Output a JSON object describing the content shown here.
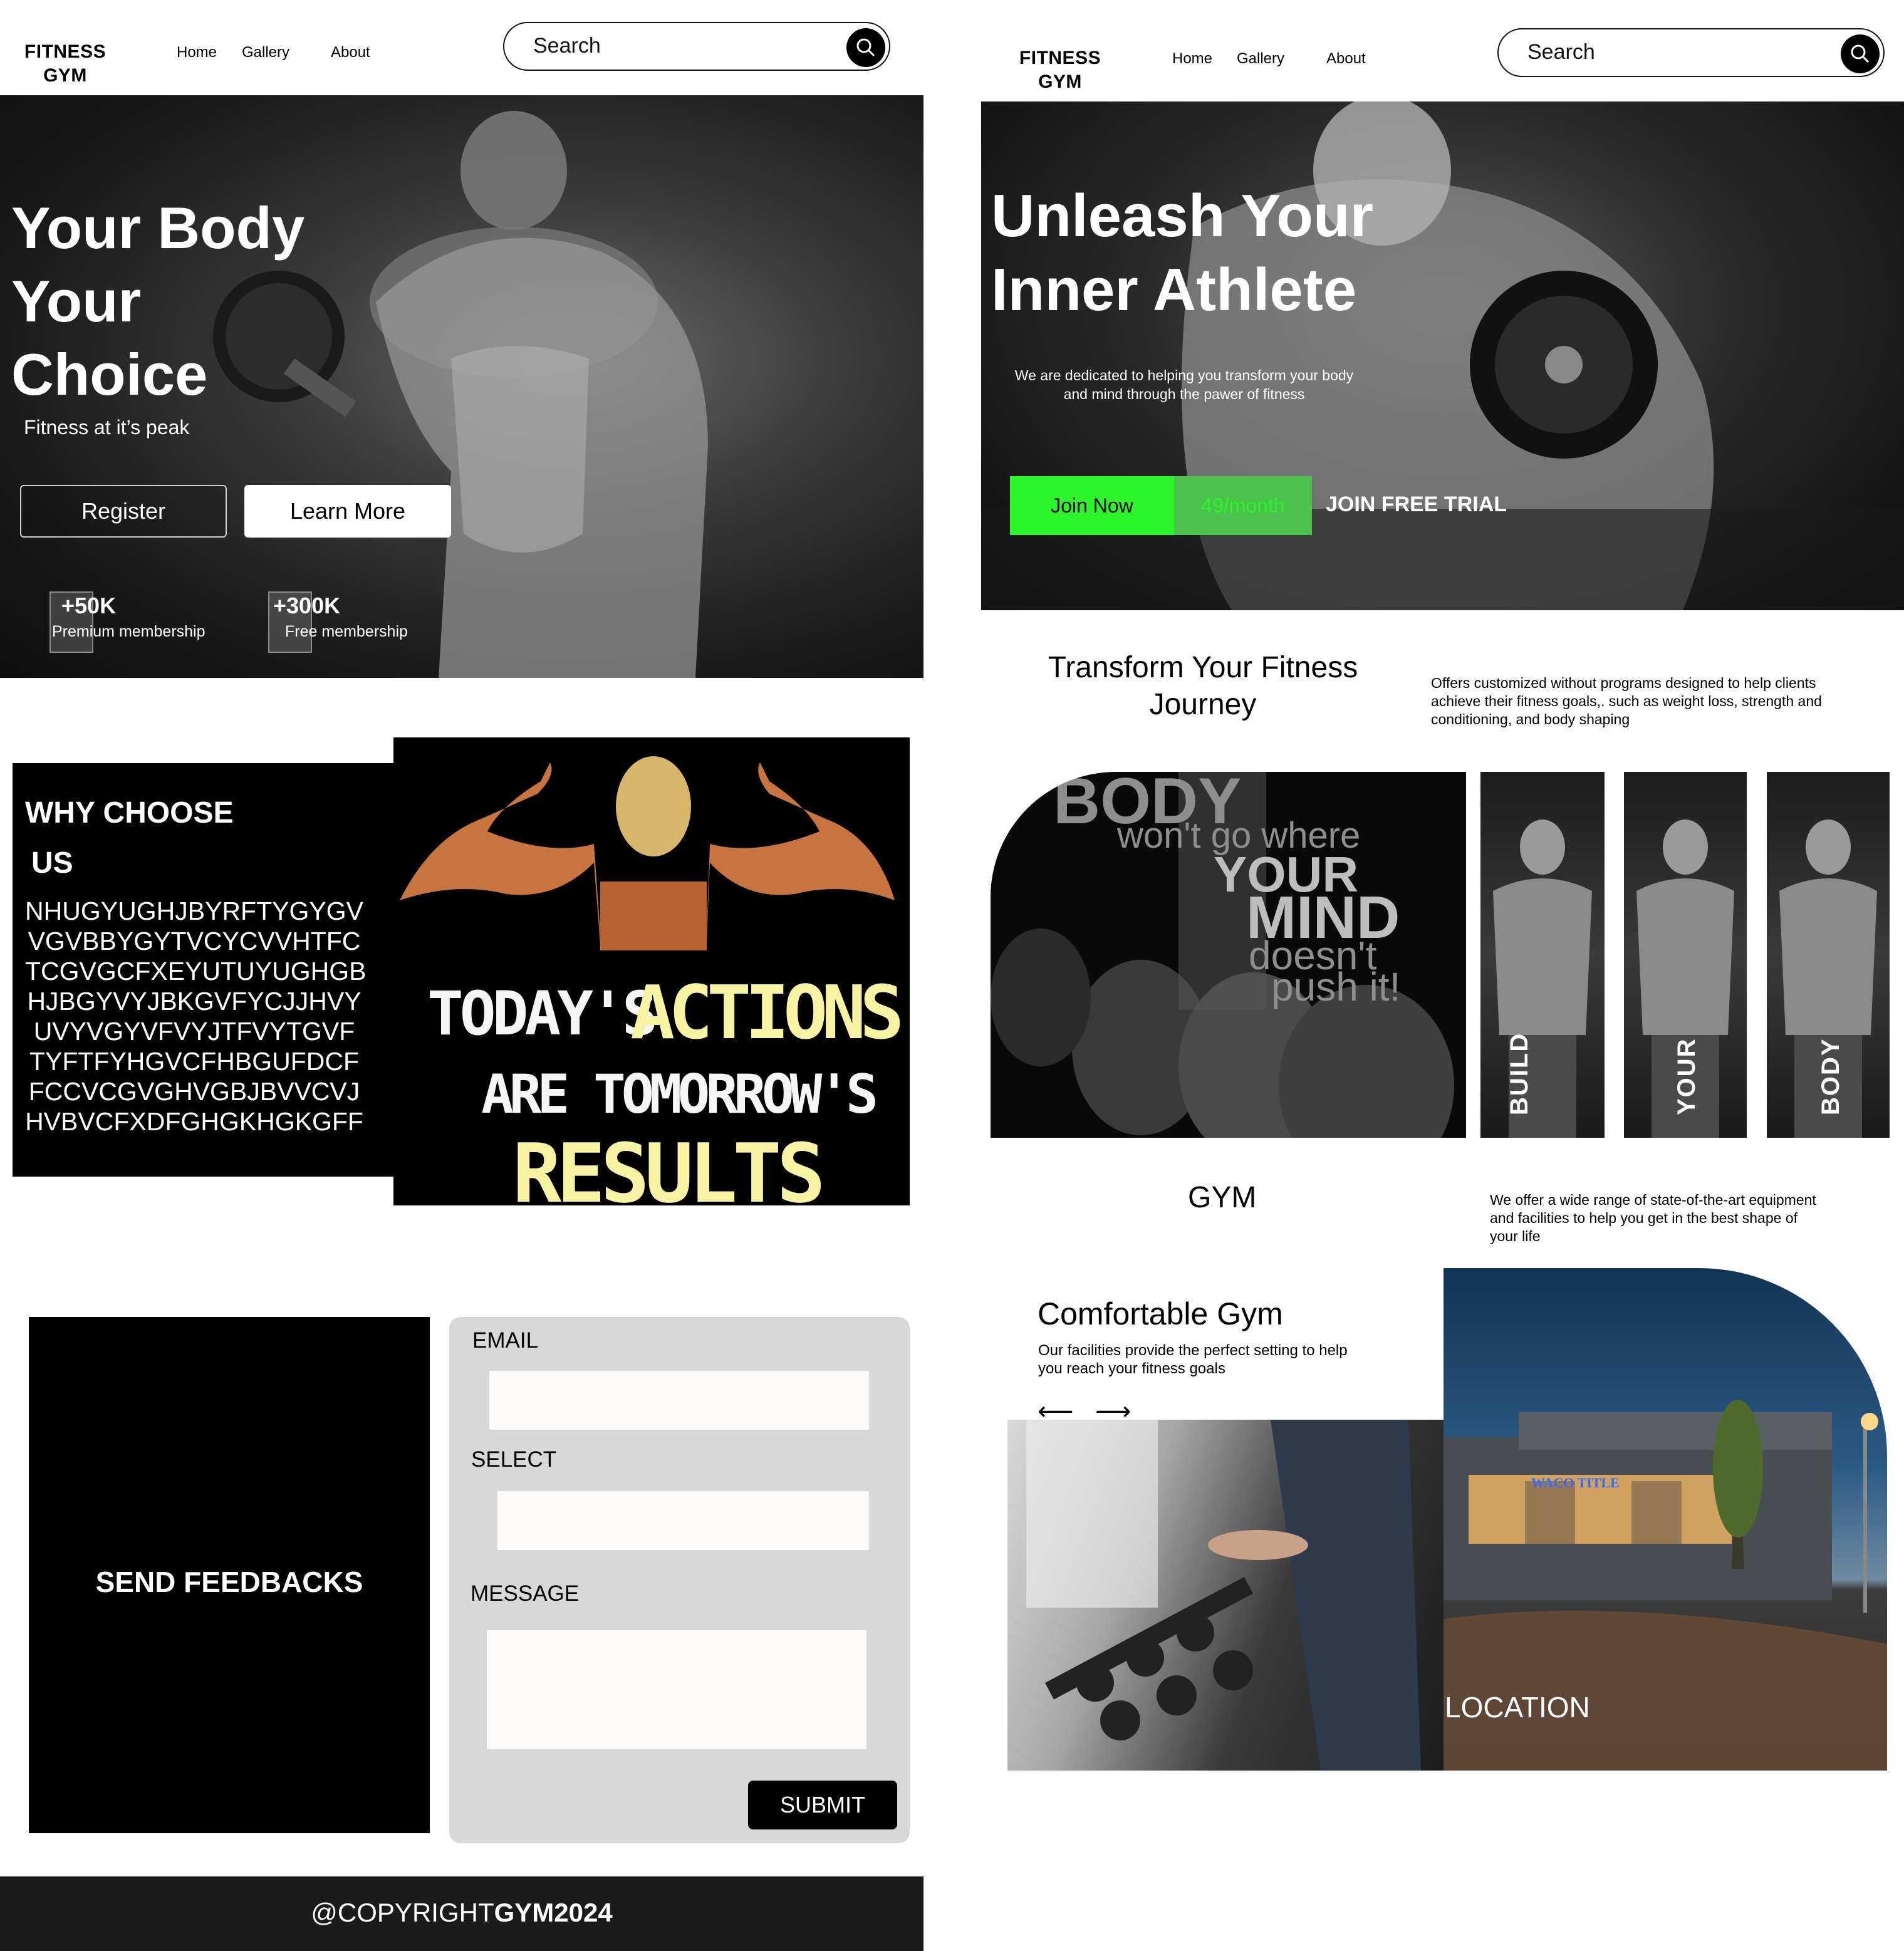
{
  "left": {
    "header": {
      "brand_line1": "FITNESS",
      "brand_line2": "GYM",
      "nav": [
        "Home",
        "Gallery",
        "About"
      ],
      "search_placeholder": "Search"
    },
    "hero": {
      "title_line1": "Your Body",
      "title_line2": "Your",
      "title_line3": "Choice",
      "subtitle": "Fitness at it’s peak",
      "register_label": "Register",
      "learn_more_label": "Learn More",
      "stats": [
        {
          "value": "+50K",
          "label": "Premium membership"
        },
        {
          "value": "+300K",
          "label": "Free membership"
        }
      ]
    },
    "why": {
      "title_line1": "WHY CHOOSE",
      "title_line2": "US",
      "lines": [
        "NHUGYUGHJBYRFTYGYGV",
        "VGVBBYGYTVCYCVVHTFC",
        "TCGVGCFXEYUTUYUGHGB",
        "HJBGYVYJBKGVFYCJJHVY",
        "UVYVGYVFVYJTFVYTGVF",
        "TYFTFYHGVCFHBGUFDCF",
        "FCCVCGVGHVGBJBVVCVJ",
        "HVBVCFXDFGHGKHGKGFF"
      ],
      "poster_line1a": "TODAY'S",
      "poster_line1b": "ACTIONS",
      "poster_line2": "ARE TOMORROW'S",
      "poster_line3": "RESULTS"
    },
    "feedback": {
      "panel_title": "SEND FEEDBACKS",
      "email_label": "EMAIL",
      "select_label": "SELECT",
      "message_label": "MESSAGE",
      "submit_label": "SUBMIT"
    },
    "footer": {
      "prefix": "@COPYRIGHT",
      "bold": "GYM2024"
    }
  },
  "right": {
    "header": {
      "brand_line1": "FITNESS",
      "brand_line2": "GYM",
      "nav": [
        "Home",
        "Gallery",
        "About"
      ],
      "search_placeholder": "Search"
    },
    "hero": {
      "title_line1": "Unleash Your",
      "title_line2": "Inner Athlete",
      "desc_line1": "We are dedicated  to helping you transform your body",
      "desc_line2": "and mind through the pawer of fitness",
      "join_label": "Join Now",
      "price_label": "49/month",
      "trial_label": "JOIN FREE TRIAL"
    },
    "transform": {
      "title_line1": "Transform Your Fitness",
      "title_line2": "Journey",
      "desc_line1": "Offers customized without programs designed to help clients",
      "desc_line2": "achieve their fitness goals,. such as weight loss, strength and",
      "desc_line3": "conditioning, and body shaping"
    },
    "gallery": {
      "quote_line1": "BODY",
      "quote_line2": "won't go where",
      "quote_line3": "YOUR",
      "quote_line4": "MIND",
      "quote_line5": "doesn't",
      "quote_line6": "push it!",
      "strips": [
        "BUILD",
        "YOUR",
        "BODY"
      ]
    },
    "gym": {
      "title": "GYM",
      "desc_line1": "We offer a wide range of state-of-the-art equipment",
      "desc_line2": "and facilities to help you get in the best shape of",
      "desc_line3": "your life"
    },
    "comfort": {
      "title": "Comfortable Gym",
      "desc_line1": "Our facilities provide the perfect setting to help",
      "desc_line2": "you reach your fitness goals",
      "prev_arrow": "⟵",
      "next_arrow": "⟶",
      "location_label": "LOCATION",
      "sign_text": "WACO TITLE"
    }
  },
  "colors": {
    "accent_green": "#2cf52c",
    "price_green": "#4cc24c",
    "form_bg": "#d8d8d8",
    "poster_yellow": "#f6f3a3"
  }
}
